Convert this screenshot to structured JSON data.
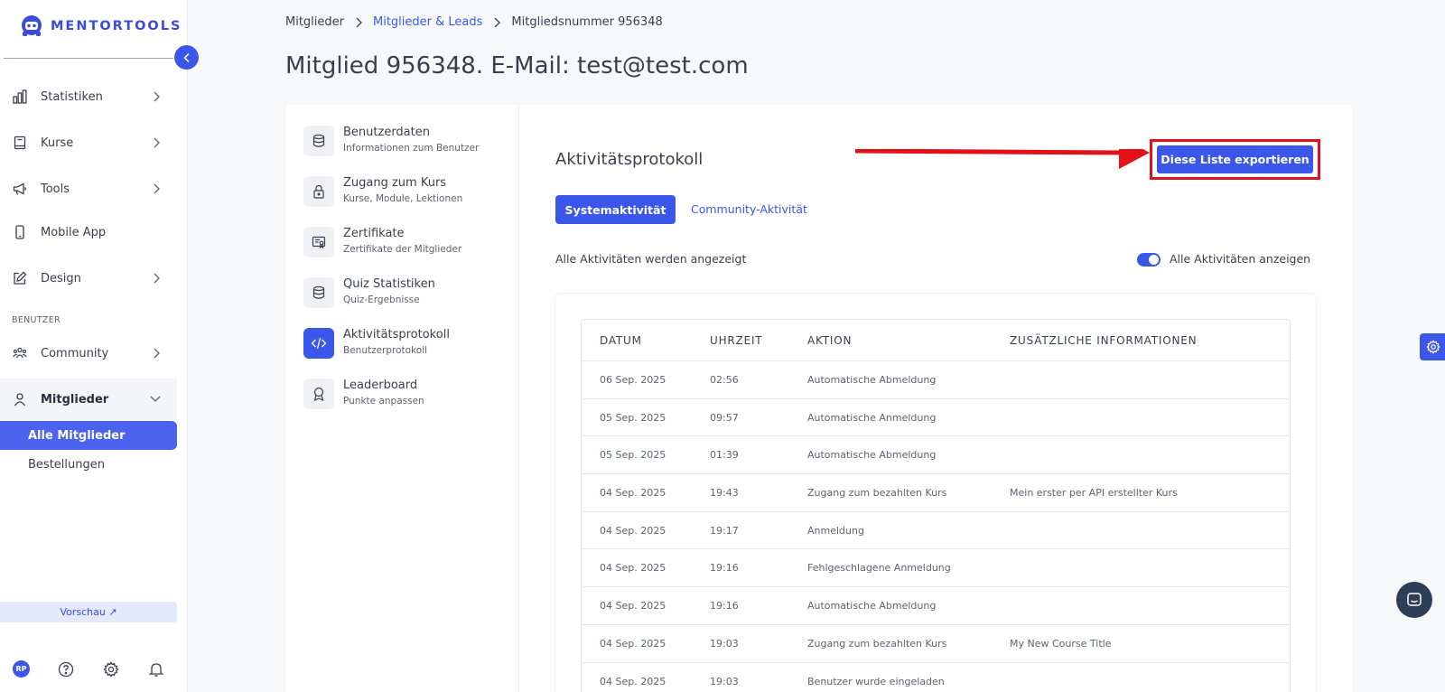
{
  "brand": {
    "name": "MENTORTOOLS"
  },
  "sidebar": {
    "items": [
      {
        "label": "Statistiken",
        "icon": "bar-chart-icon"
      },
      {
        "label": "Kurse",
        "icon": "book-icon"
      },
      {
        "label": "Tools",
        "icon": "megaphone-icon"
      },
      {
        "label": "Mobile App",
        "icon": "mobile-icon"
      },
      {
        "label": "Design",
        "icon": "pen-icon"
      }
    ],
    "section_label": "BENUTZER",
    "community": {
      "label": "Community",
      "icon": "users-icon"
    },
    "members": {
      "label": "Mitglieder",
      "icon": "user-icon"
    },
    "sub_items": [
      {
        "label": "Alle Mitglieder"
      },
      {
        "label": "Bestellungen"
      }
    ],
    "preview_label": "Vorschau ↗",
    "avatar_initials": "RP"
  },
  "breadcrumb": {
    "first": "Mitglieder",
    "second": "Mitglieder & Leads",
    "third": "Mitgliedsnummer 956348"
  },
  "page_title": "Mitglied 956348. E-Mail: test@test.com",
  "member_menu": [
    {
      "title": "Benutzerdaten",
      "sub": "Informationen zum Benutzer"
    },
    {
      "title": "Zugang zum Kurs",
      "sub": "Kurse, Module, Lektionen"
    },
    {
      "title": "Zertifikate",
      "sub": "Zertifikate der Mitglieder"
    },
    {
      "title": "Quiz Statistiken",
      "sub": "Quiz-Ergebnisse"
    },
    {
      "title": "Aktivitätsprotokoll",
      "sub": "Benutzerprotokoll"
    },
    {
      "title": "Leaderboard",
      "sub": "Punkte anpassen"
    }
  ],
  "activity": {
    "title": "Aktivitätsprotokoll",
    "export_label": "Diese Liste exportieren",
    "tab_system": "Systemaktivität",
    "tab_community": "Community-Aktivität",
    "status_text": "Alle Aktivitäten werden angezeigt",
    "toggle_label": "Alle Aktivitäten anzeigen",
    "toggle_on": true,
    "columns": [
      "DATUM",
      "UHRZEIT",
      "AKTION",
      "ZUSÄTZLICHE INFORMATIONEN"
    ],
    "rows": [
      {
        "date": "06 Sep. 2025",
        "time": "02:56",
        "action": "Automatische Abmeldung",
        "info": ""
      },
      {
        "date": "05 Sep. 2025",
        "time": "09:57",
        "action": "Automatische Anmeldung",
        "info": ""
      },
      {
        "date": "05 Sep. 2025",
        "time": "01:39",
        "action": "Automatische Abmeldung",
        "info": ""
      },
      {
        "date": "04 Sep. 2025",
        "time": "19:43",
        "action": "Zugang zum bezahlten Kurs",
        "info": "Mein erster per API erstellter Kurs"
      },
      {
        "date": "04 Sep. 2025",
        "time": "19:17",
        "action": "Anmeldung",
        "info": ""
      },
      {
        "date": "04 Sep. 2025",
        "time": "19:16",
        "action": "Fehlgeschlagene Anmeldung",
        "info": ""
      },
      {
        "date": "04 Sep. 2025",
        "time": "19:16",
        "action": "Automatische Abmeldung",
        "info": ""
      },
      {
        "date": "04 Sep. 2025",
        "time": "19:03",
        "action": "Zugang zum bezahlten Kurs",
        "info": "My New Course Title"
      },
      {
        "date": "04 Sep. 2025",
        "time": "19:03",
        "action": "Benutzer wurde eingeladen",
        "info": ""
      }
    ]
  },
  "colors": {
    "accent": "#3b57ea",
    "highlight": "#e4101a",
    "chat": "#2f3e57"
  }
}
